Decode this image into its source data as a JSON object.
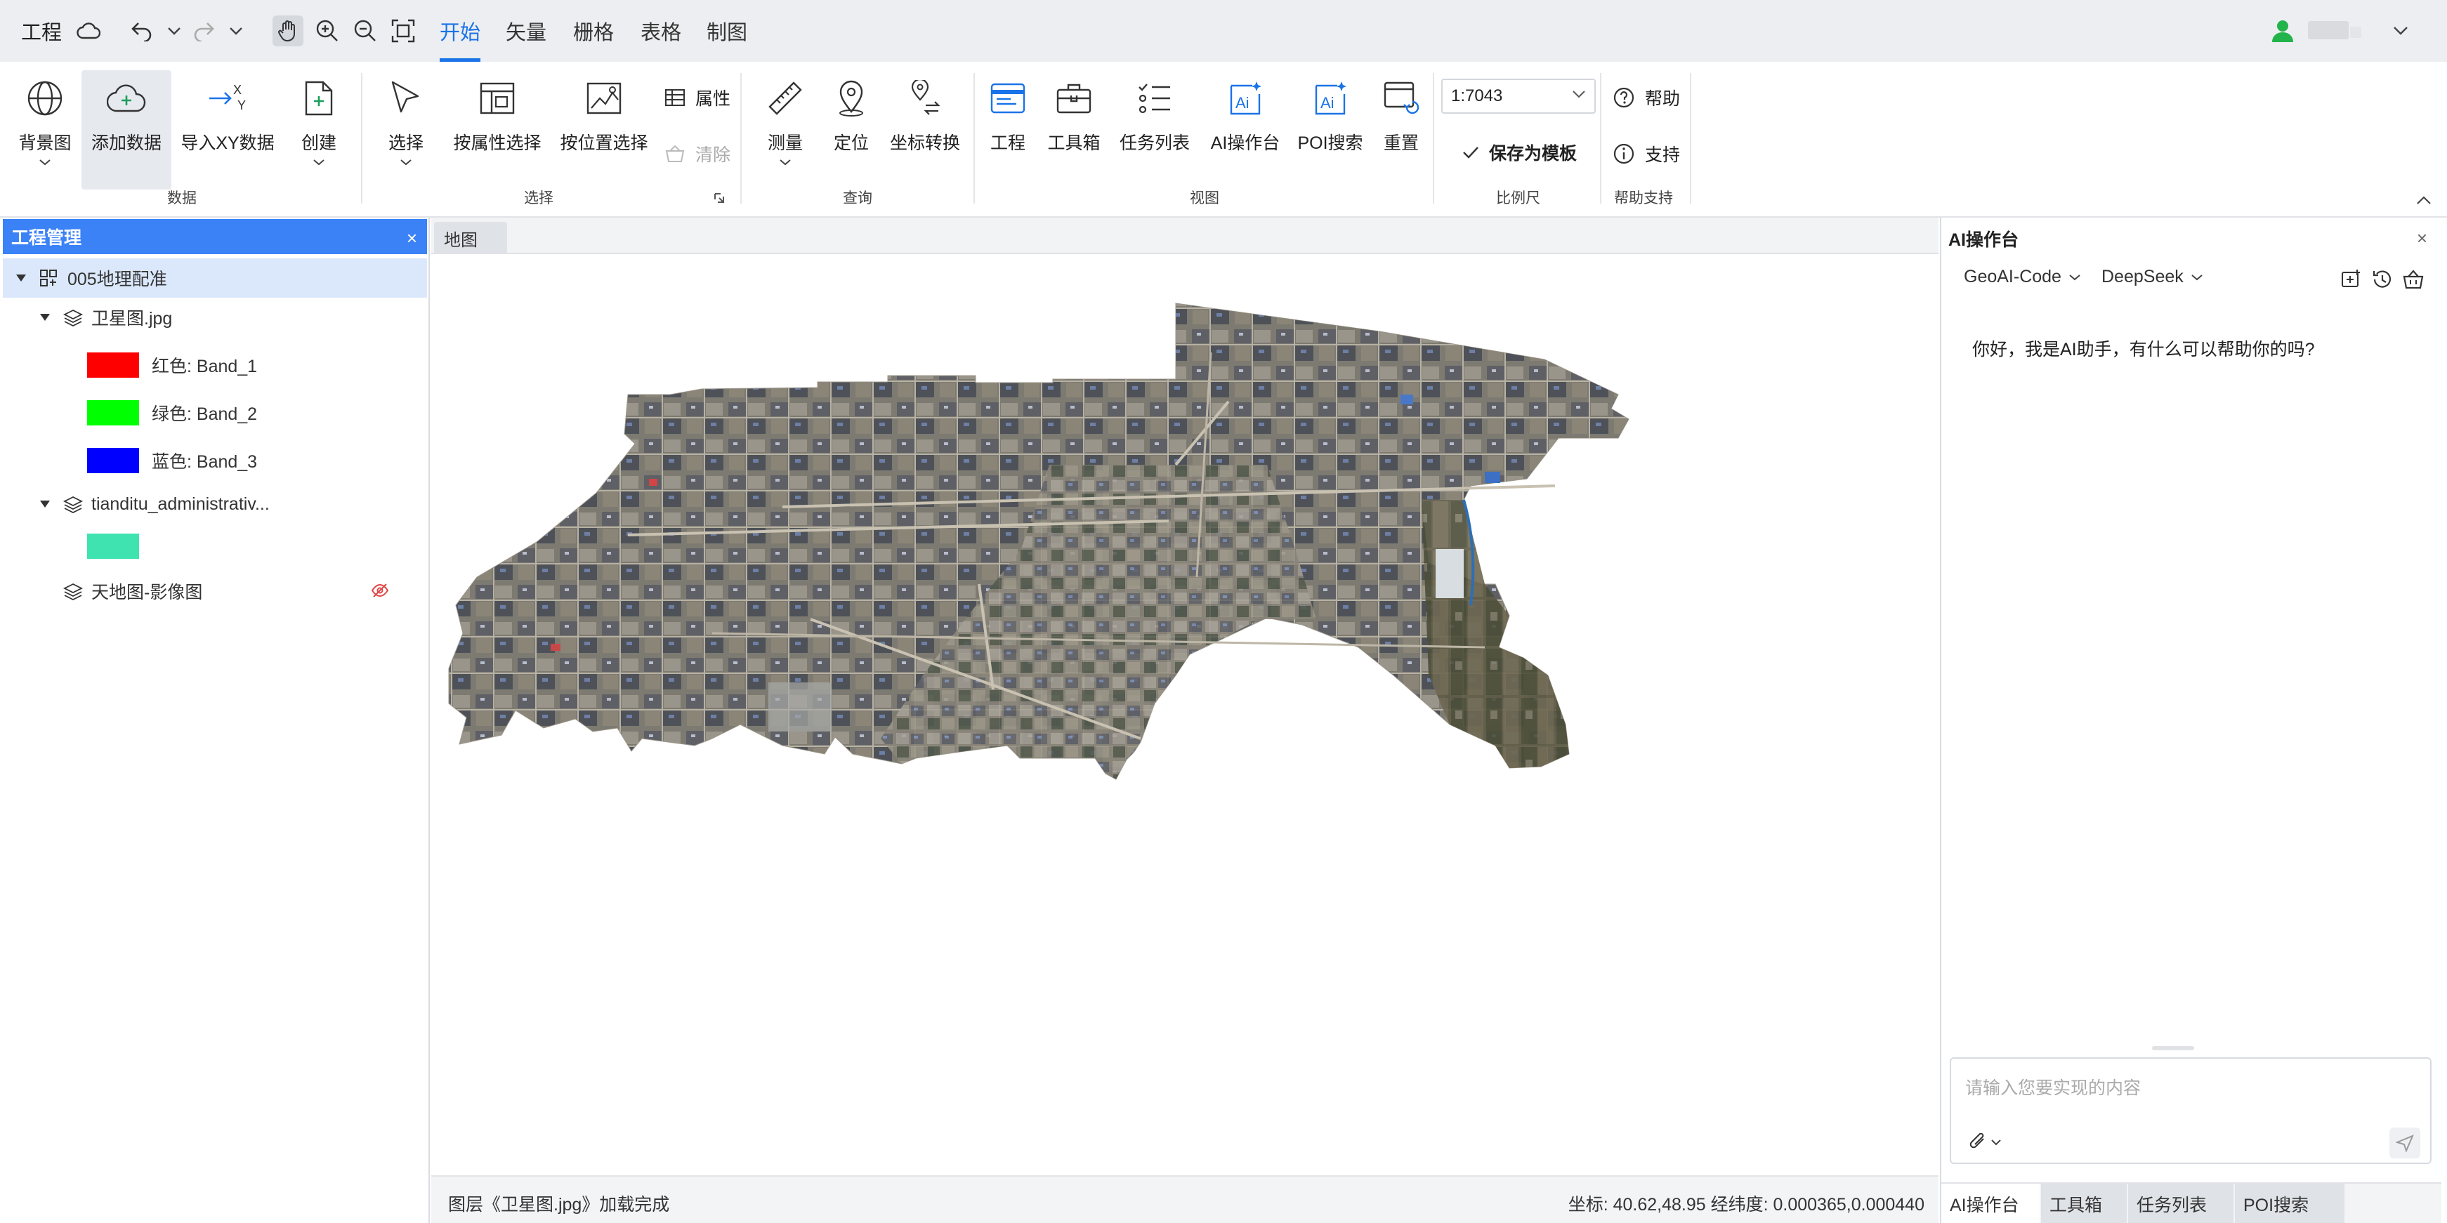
{
  "topbar": {
    "project": "工程",
    "tabs": [
      {
        "label": "开始",
        "active": true
      },
      {
        "label": "矢量",
        "active": false
      },
      {
        "label": "栅格",
        "active": false
      },
      {
        "label": "表格",
        "active": false
      },
      {
        "label": "制图",
        "active": false
      }
    ],
    "accent_color": "#1a73e8"
  },
  "ribbon": {
    "data_group": {
      "title": "数据",
      "items": [
        "背景图",
        "添加数据",
        "导入XY数据",
        "创建"
      ]
    },
    "select_group": {
      "title": "选择",
      "items": [
        "选择",
        "按属性选择",
        "按位置选择"
      ],
      "attr": "属性",
      "clear": "清除"
    },
    "query_group": {
      "title": "查询",
      "items": [
        "测量",
        "定位",
        "坐标转换"
      ]
    },
    "view_group": {
      "title": "视图",
      "items": [
        "工程",
        "工具箱",
        "任务列表",
        "AI操作台",
        "POI搜索",
        "重置"
      ]
    },
    "scale_group": {
      "title": "比例尺",
      "scale": "1:7043",
      "save_template": "保存为模板"
    },
    "help_group": {
      "title": "帮助支持",
      "help": "帮助",
      "support": "支持"
    }
  },
  "left_panel": {
    "title": "工程管理",
    "close": "×",
    "project_name": "005地理配准",
    "layers": [
      {
        "name": "卫星图.jpg",
        "bands": [
          {
            "label": "红色: Band_1",
            "color": "#ff0000"
          },
          {
            "label": "绿色: Band_2",
            "color": "#00ff00"
          },
          {
            "label": "蓝色: Band_3",
            "color": "#0000ff"
          }
        ]
      },
      {
        "name": "tianditu_administrativ...",
        "swatch": "#3ee3b0"
      },
      {
        "name": "天地图-影像图",
        "hidden": true
      }
    ]
  },
  "map": {
    "tab": "地图",
    "status_left": "图层《卫星图.jpg》加载完成",
    "status_right": "坐标: 40.62,48.95 经纬度: 0.000365,0.000440"
  },
  "ai_panel": {
    "title": "AI操作台",
    "close": "×",
    "model_a": "GeoAI-Code",
    "model_b": "DeepSeek",
    "greeting": "你好，我是AI助手，有什么可以帮助你的吗?",
    "input_placeholder": "请输入您要实现的内容",
    "tabs": [
      "AI操作台",
      "工具箱",
      "任务列表",
      "POI搜索"
    ]
  }
}
